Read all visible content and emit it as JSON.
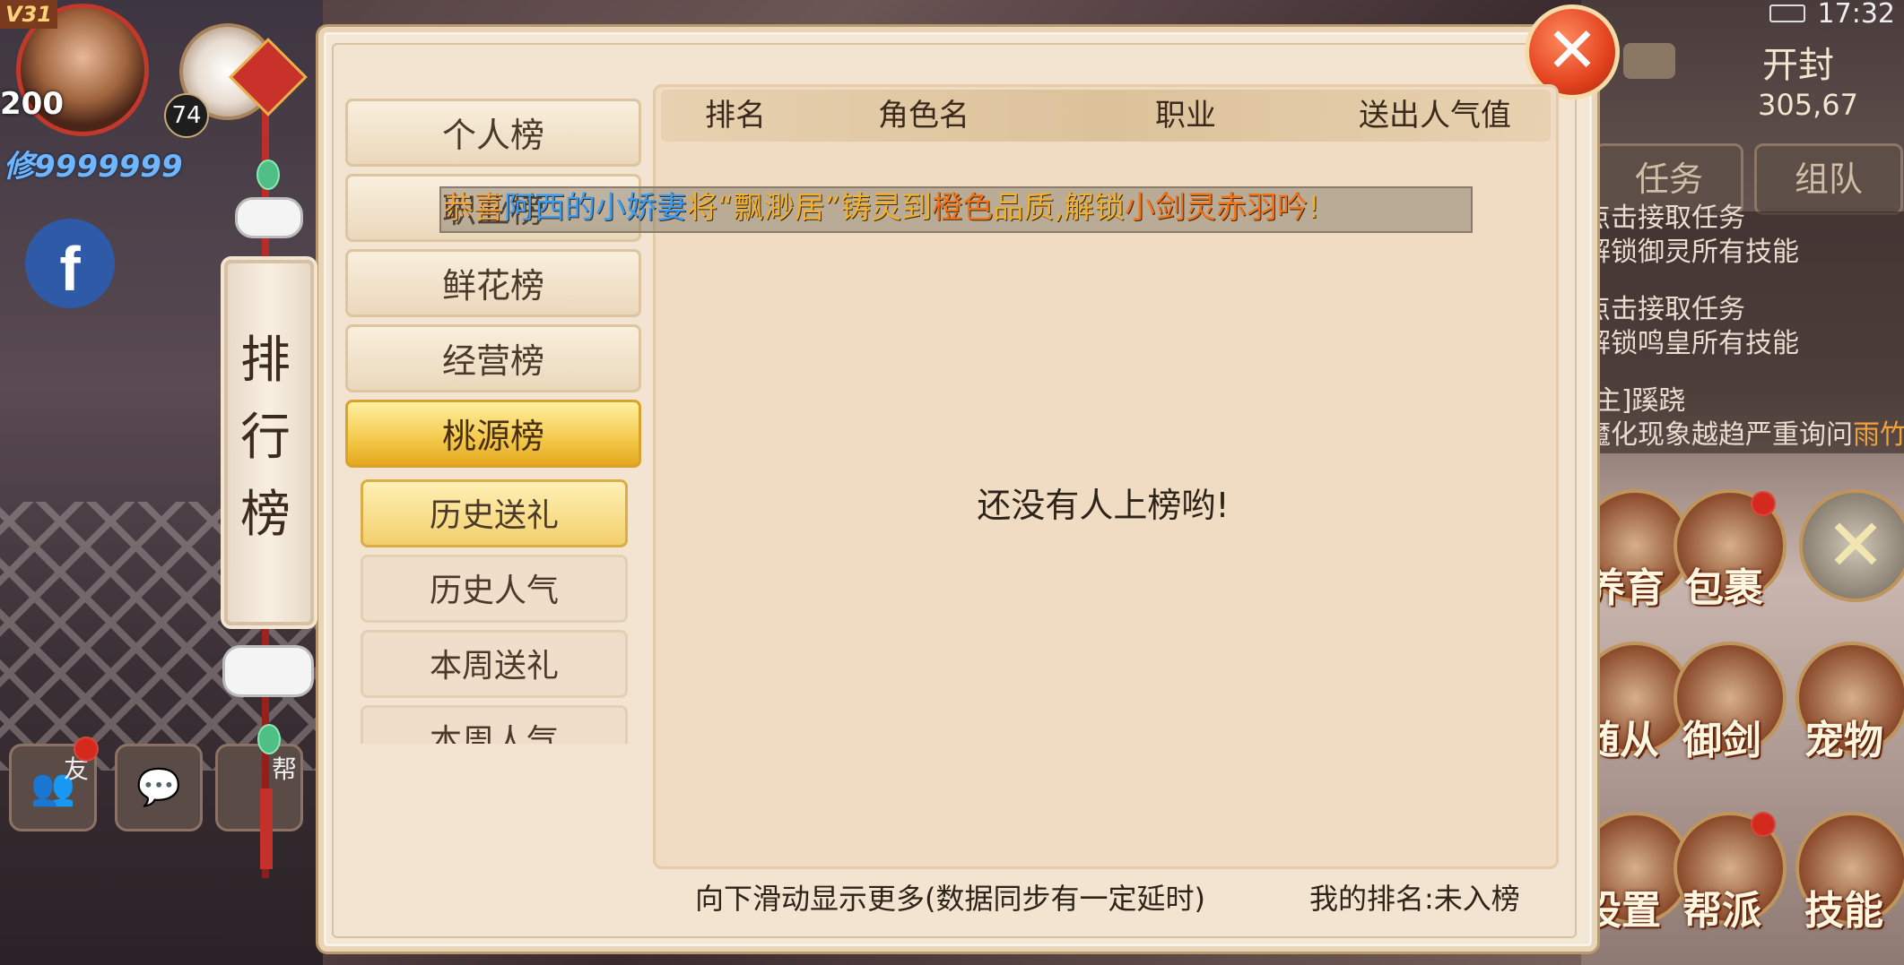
{
  "status": {
    "time": "17:32"
  },
  "hud": {
    "vip": "V31",
    "level": "200",
    "pet_level": "74",
    "cultivation": "修9999999",
    "map_name": "开封",
    "coords": "305,67",
    "tab_task": "任务",
    "tab_team": "组队"
  },
  "tasks": [
    {
      "text": "点击接取任务"
    },
    {
      "text": "解锁御灵所有技能"
    },
    {
      "text": "点击接取任务"
    },
    {
      "text": "解锁鸣皇所有技能"
    },
    {
      "text": "[主]蹊跷"
    },
    {
      "text_main": "魔化现象越趋严重询问",
      "text_accent": "雨竹"
    }
  ],
  "skills": {
    "row1": [
      "养育",
      "包裹"
    ],
    "row2": [
      "随从",
      "御剑",
      "宠物"
    ],
    "row3": [
      "设置",
      "帮派",
      "技能"
    ]
  },
  "chat_labels": {
    "friend": "友",
    "gang": "帮"
  },
  "ornament": {
    "title": [
      "排",
      "行",
      "榜"
    ]
  },
  "nav": [
    {
      "label": "个人榜"
    },
    {
      "label": "职业榜"
    },
    {
      "label": "鲜花榜"
    },
    {
      "label": "经营榜"
    },
    {
      "label": "桃源榜",
      "active": true
    }
  ],
  "sub_nav": [
    {
      "label": "历史送礼",
      "active": true
    },
    {
      "label": "历史人气"
    },
    {
      "label": "本周送礼"
    },
    {
      "label": "本周人气"
    }
  ],
  "table": {
    "headers": [
      "排名",
      "角色名",
      "职业",
      "送出人气值"
    ],
    "empty_message": "还没有人上榜哟!"
  },
  "broadcast": [
    {
      "text": "恭喜",
      "color": "#f2a64a"
    },
    {
      "text": "阿西的小娇妻",
      "color": "#3a9cf4"
    },
    {
      "text": "将“飘渺居”铸灵到",
      "color": "#f0b030"
    },
    {
      "text": "橙色",
      "color": "#f27418"
    },
    {
      "text": "品质,解锁",
      "color": "#f0b030"
    },
    {
      "text": "小剑灵赤羽吟",
      "color": "#f27418"
    },
    {
      "text": "!",
      "color": "#f0b030"
    }
  ],
  "footer": {
    "hint": "向下滑动显示更多(数据同步有一定延时)",
    "my_rank_label": "我的排名:",
    "my_rank_value": "未入榜"
  },
  "icons": {
    "close": "close-x-icon",
    "facebook": "facebook-icon",
    "camera": "camera-icon",
    "friends": "friends-icon",
    "chat": "chat-bubble-icon"
  }
}
